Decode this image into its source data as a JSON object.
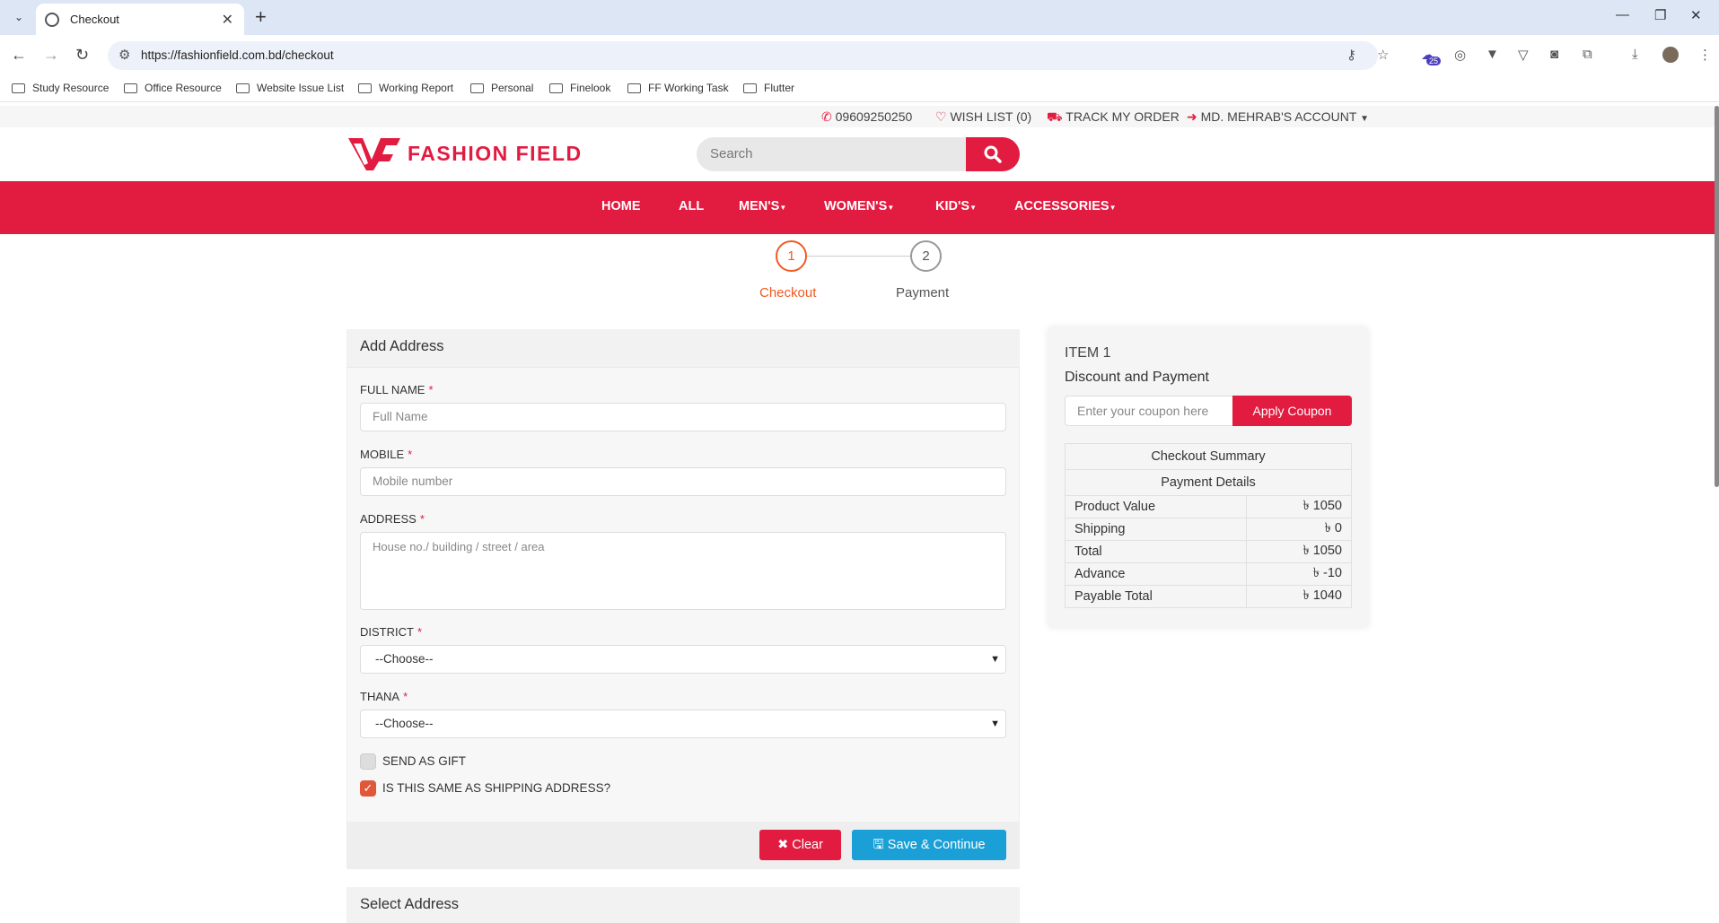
{
  "browser": {
    "tab_title": "Checkout",
    "url": "https://fashionfield.com.bd/checkout",
    "bookmarks": [
      "Study Resource",
      "Office Resource",
      "Website Issue List",
      "Working Report",
      "Personal",
      "Finelook",
      "FF Working Task",
      "Flutter"
    ],
    "extension_badge": "25"
  },
  "topbar": {
    "phone": "09609250250",
    "wishlist": "WISH LIST (0)",
    "track": "TRACK MY ORDER",
    "account": "MD. MEHRAB'S ACCOUNT"
  },
  "header": {
    "logo_text": "FASHION FIELD",
    "search_placeholder": "Search"
  },
  "nav": {
    "items": [
      "HOME",
      "ALL",
      "MEN'S",
      "WOMEN'S",
      "KID'S",
      "ACCESSORIES"
    ]
  },
  "stepper": {
    "steps": [
      {
        "number": "1",
        "label": "Checkout"
      },
      {
        "number": "2",
        "label": "Payment"
      }
    ]
  },
  "address_form": {
    "title": "Add Address",
    "full_name_label": "FULL NAME",
    "full_name_placeholder": "Full Name",
    "mobile_label": "MOBILE",
    "mobile_placeholder": "Mobile number",
    "address_label": "ADDRESS",
    "address_placeholder": "House no./ building / street / area",
    "district_label": "DISTRICT",
    "district_value": "--Choose--",
    "thana_label": "THANA",
    "thana_value": "--Choose--",
    "gift_label": "SEND AS GIFT",
    "same_shipping_label": "IS THIS SAME AS SHIPPING ADDRESS?",
    "clear_button": "Clear",
    "save_button": "Save & Continue"
  },
  "select_address": {
    "title": "Select Address"
  },
  "summary": {
    "item_heading": "ITEM 1",
    "discount_heading": "Discount and Payment",
    "coupon_placeholder": "Enter your coupon here",
    "apply_button": "Apply Coupon",
    "table_title": "Checkout Summary",
    "table_subtitle": "Payment Details",
    "rows": [
      {
        "label": "Product Value",
        "value": "৳ 1050"
      },
      {
        "label": "Shipping",
        "value": "৳ 0"
      },
      {
        "label": "Total",
        "value": "৳ 1050"
      },
      {
        "label": "Advance",
        "value": "৳ -10"
      },
      {
        "label": "Payable Total",
        "value": "৳ 1040"
      }
    ]
  },
  "colors": {
    "brand": "#e21b40",
    "step_active": "#f05a22",
    "save_button": "#1aa0d6"
  }
}
